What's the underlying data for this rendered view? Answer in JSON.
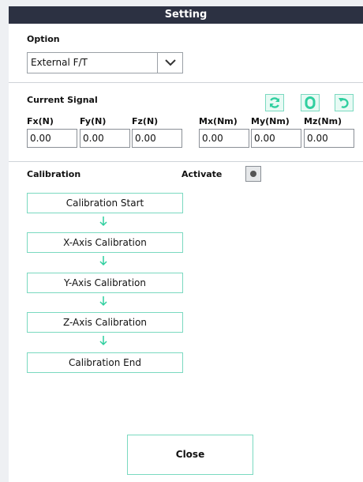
{
  "window": {
    "title": "Setting"
  },
  "option": {
    "label": "Option",
    "selected": "External F/T"
  },
  "signal": {
    "label": "Current Signal",
    "buttons": [
      {
        "icon": "refresh-icon"
      },
      {
        "icon": "zero-icon"
      },
      {
        "icon": "undo-icon"
      }
    ],
    "columns": [
      {
        "label": "Fx(N)",
        "value": "0.00"
      },
      {
        "label": "Fy(N)",
        "value": "0.00"
      },
      {
        "label": "Fz(N)",
        "value": "0.00"
      },
      {
        "label": "Mx(Nm)",
        "value": "0.00"
      },
      {
        "label": "My(Nm)",
        "value": "0.00"
      },
      {
        "label": "Mz(Nm)",
        "value": "0.00"
      }
    ]
  },
  "calibration": {
    "label": "Calibration",
    "activate_label": "Activate",
    "steps": [
      "Calibration Start",
      "X-Axis Calibration",
      "Y-Axis Calibration",
      "Z-Axis Calibration",
      "Calibration End"
    ]
  },
  "footer": {
    "close_label": "Close"
  },
  "colors": {
    "titlebar": "#2c3142",
    "accent": "#2fcf9f",
    "accent_border": "#7ad9c0"
  }
}
